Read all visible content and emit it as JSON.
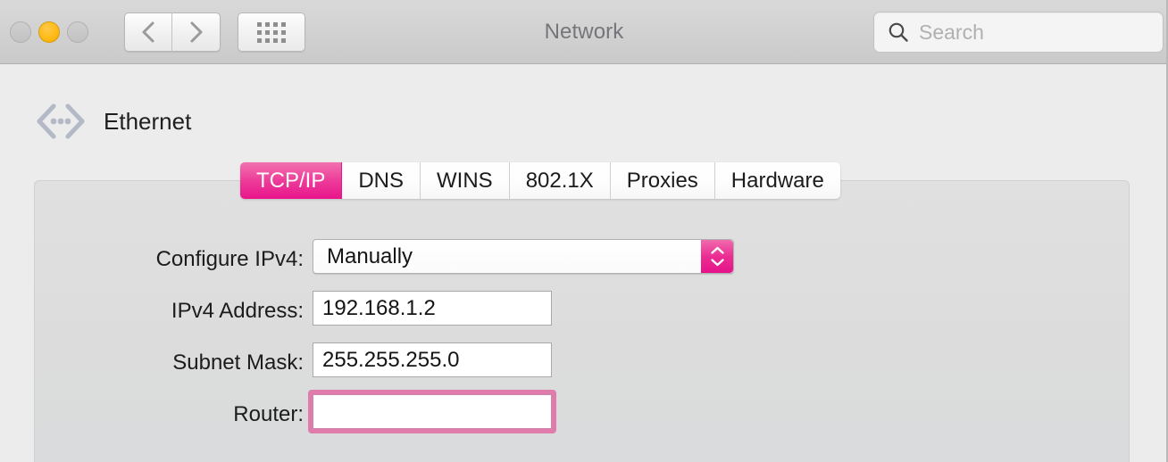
{
  "window": {
    "title": "Network",
    "traffic_lights": [
      {
        "name": "close",
        "state": "inactive",
        "color": "#c8c8c8"
      },
      {
        "name": "minimize",
        "state": "active",
        "color": "#fdb913"
      },
      {
        "name": "zoom",
        "state": "inactive",
        "color": "#c8c8c8"
      }
    ]
  },
  "toolbar": {
    "back_icon": "chevron-left-icon",
    "forward_icon": "chevron-right-icon",
    "show_all_icon": "grid-icon",
    "search": {
      "icon": "search-icon",
      "value": "",
      "placeholder": "Search"
    }
  },
  "interface": {
    "icon": "ethernet-icon",
    "name": "Ethernet"
  },
  "tabs": [
    {
      "label": "TCP/IP",
      "active": true
    },
    {
      "label": "DNS",
      "active": false
    },
    {
      "label": "WINS",
      "active": false
    },
    {
      "label": "802.1X",
      "active": false
    },
    {
      "label": "Proxies",
      "active": false
    },
    {
      "label": "Hardware",
      "active": false
    }
  ],
  "form": {
    "configure_ipv4": {
      "label": "Configure IPv4:",
      "value": "Manually",
      "control": "popup-button",
      "stepper_icon": "stepper-up-down-icon"
    },
    "ipv4_address": {
      "label": "IPv4 Address:",
      "value": "192.168.1.2",
      "control": "text-field"
    },
    "subnet_mask": {
      "label": "Subnet Mask:",
      "value": "255.255.255.0",
      "control": "text-field"
    },
    "router": {
      "label": "Router:",
      "value": "",
      "control": "text-field",
      "focused": true
    }
  },
  "colors": {
    "accent_pink": "#e8148b",
    "accent_pink_light": "#f172b0",
    "focus_ring": "#e07cab",
    "window_bg": "#ececec",
    "panel_bg": "#dcdcdc",
    "toolbar_bg": "#d0d0d0"
  }
}
